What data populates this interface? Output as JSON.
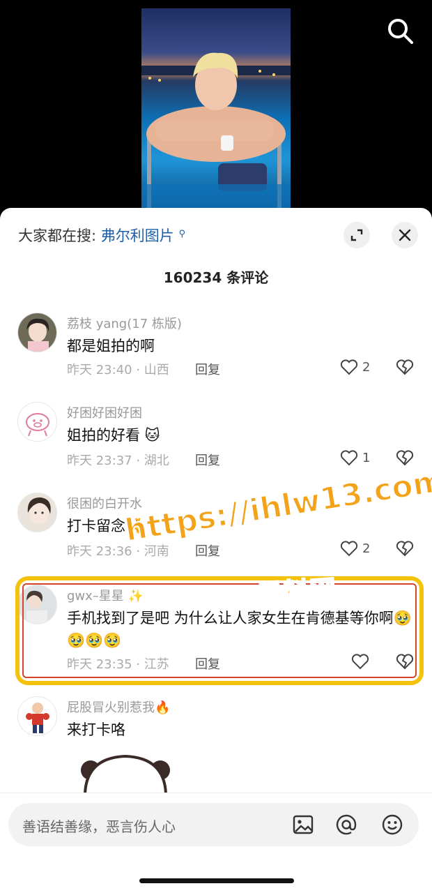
{
  "hot_search": {
    "prefix": "大家都在搜:",
    "term": "弗尔利图片",
    "suffix_icon": "search-small-icon"
  },
  "comment_count": "160234 条评论",
  "comments": [
    {
      "username": "荔枝 yang(17 栋版)",
      "text": "都是姐拍的啊",
      "time_location": "昨天 23:40 · 山西",
      "reply": "回复",
      "likes": "2",
      "avatar": "avatar-girl-photo"
    },
    {
      "username": "好困好困好困",
      "text": "姐拍的好看 🐱",
      "time_location": "昨天 23:37 · 湖北",
      "reply": "回复",
      "likes": "1",
      "avatar": "avatar-pig-drawing"
    },
    {
      "username": "很困的白开水",
      "text": "打卡留念 🫰",
      "time_location": "昨天 23:36 · 河南",
      "reply": "回复",
      "likes": "2",
      "avatar": "avatar-girl-photo"
    },
    {
      "username": "gwx–星星 ✨",
      "text": "手机找到了是吧 为什么让人家女生在肯德基等你啊🥹🥹🥹🥹",
      "time_location": "昨天 23:35 · 江苏",
      "reply": "回复",
      "likes": "",
      "avatar": "avatar-girl-photo"
    },
    {
      "username": "屁股冒火别惹我🔥",
      "text": "来打卡咯",
      "avatar": "avatar-cartoon-boxer"
    }
  ],
  "watermark": {
    "url": "https://ihlw13.com",
    "name": "黑料网"
  },
  "input": {
    "placeholder": "善语结善缘，恶言伤人心"
  },
  "icons": [
    "search-icon",
    "expand-icon",
    "close-icon",
    "heart-icon",
    "broken-heart-icon",
    "image-icon",
    "at-icon",
    "emoji-icon"
  ],
  "colors": {
    "link": "#1e5fa8",
    "highlight_border": "#f4c10c",
    "highlight_inner": "#d8412c",
    "watermark": "#f2a31a"
  }
}
